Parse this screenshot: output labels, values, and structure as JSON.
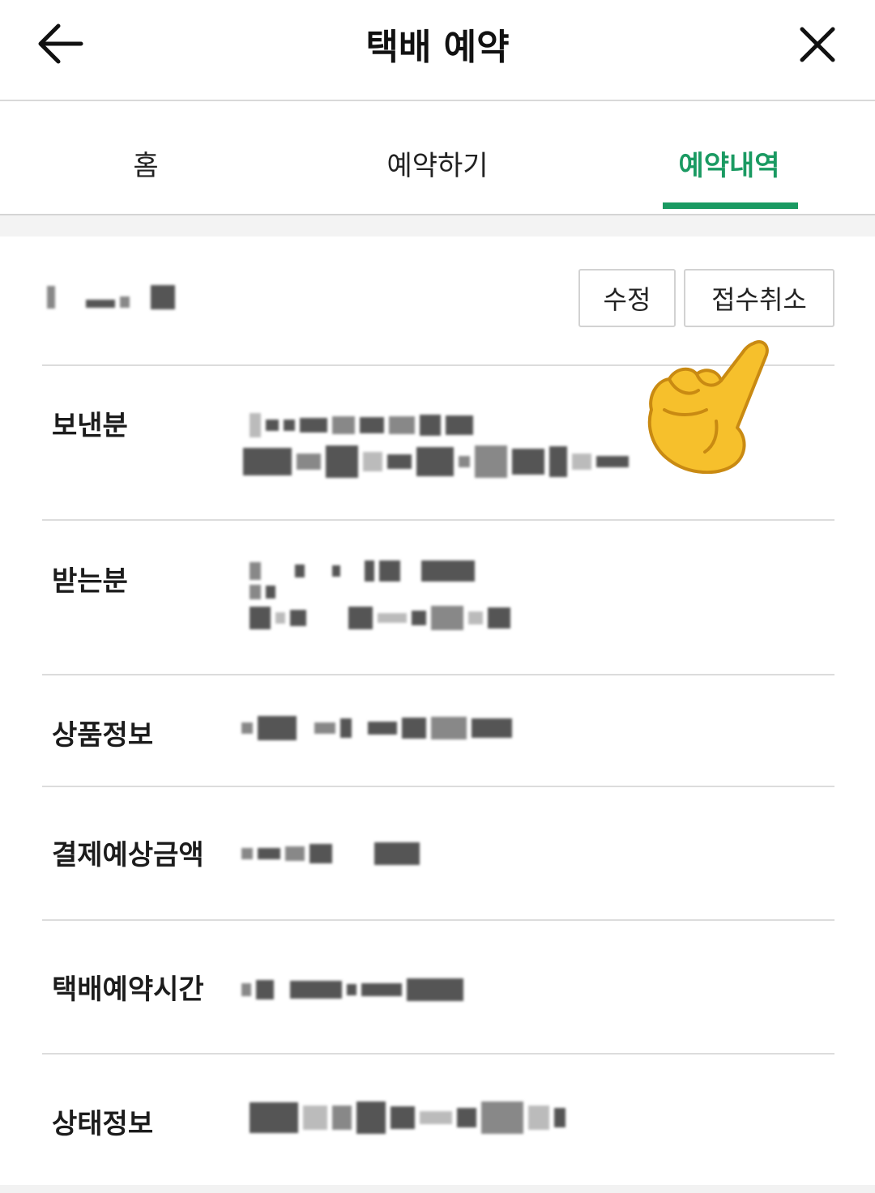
{
  "header": {
    "title": "택배 예약"
  },
  "tabs": [
    {
      "label": "홈",
      "active": false
    },
    {
      "label": "예약하기",
      "active": false
    },
    {
      "label": "예약내역",
      "active": true
    }
  ],
  "colors": {
    "accent": "#1a9a62"
  },
  "actions": {
    "edit": "수정",
    "cancel": "접수취소"
  },
  "details": {
    "sender": "보낸분",
    "receiver": "받는분",
    "product": "상품정보",
    "payment": "결제예상금액",
    "reserve_time": "택배예약시간",
    "status": "상태정보"
  },
  "icons": {
    "back": "arrow-left-icon",
    "close": "close-icon",
    "hand": "pointing-hand-emoji"
  }
}
